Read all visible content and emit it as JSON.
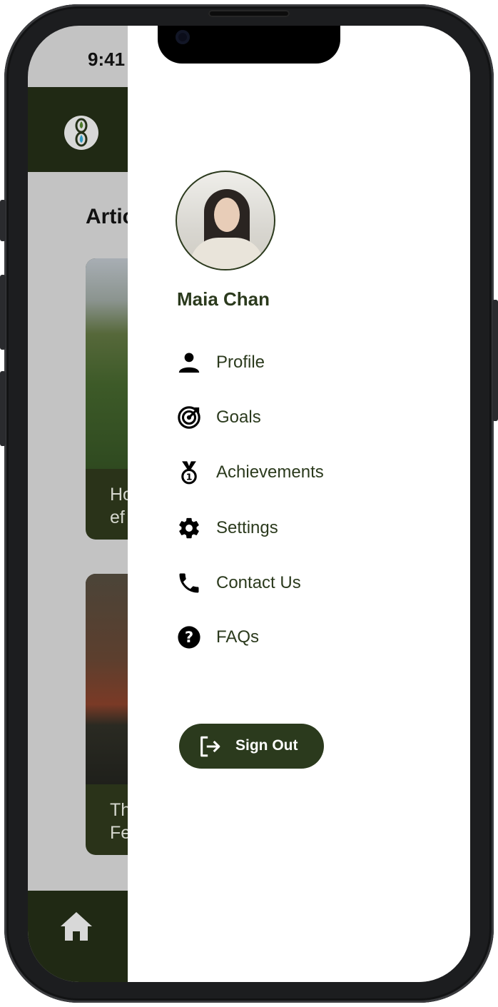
{
  "status_bar": {
    "time": "9:41"
  },
  "background": {
    "section_title": "Artic",
    "cards": [
      {
        "text_line1": "Ho",
        "text_line2": "ef"
      },
      {
        "text_line1": "Th",
        "text_line2": "Fe"
      }
    ]
  },
  "drawer": {
    "user_name": "Maia Chan",
    "menu": [
      {
        "label": "Profile",
        "icon": "person-icon"
      },
      {
        "label": "Goals",
        "icon": "target-icon"
      },
      {
        "label": "Achievements",
        "icon": "medal-icon"
      },
      {
        "label": "Settings",
        "icon": "gear-icon"
      },
      {
        "label": "Contact Us",
        "icon": "phone-icon"
      },
      {
        "label": "FAQs",
        "icon": "help-icon"
      }
    ],
    "sign_out_label": "Sign Out"
  },
  "colors": {
    "brand_dark": "#2b3a1d",
    "header_bg": "#202914",
    "overlay": "#c3c3c3"
  }
}
